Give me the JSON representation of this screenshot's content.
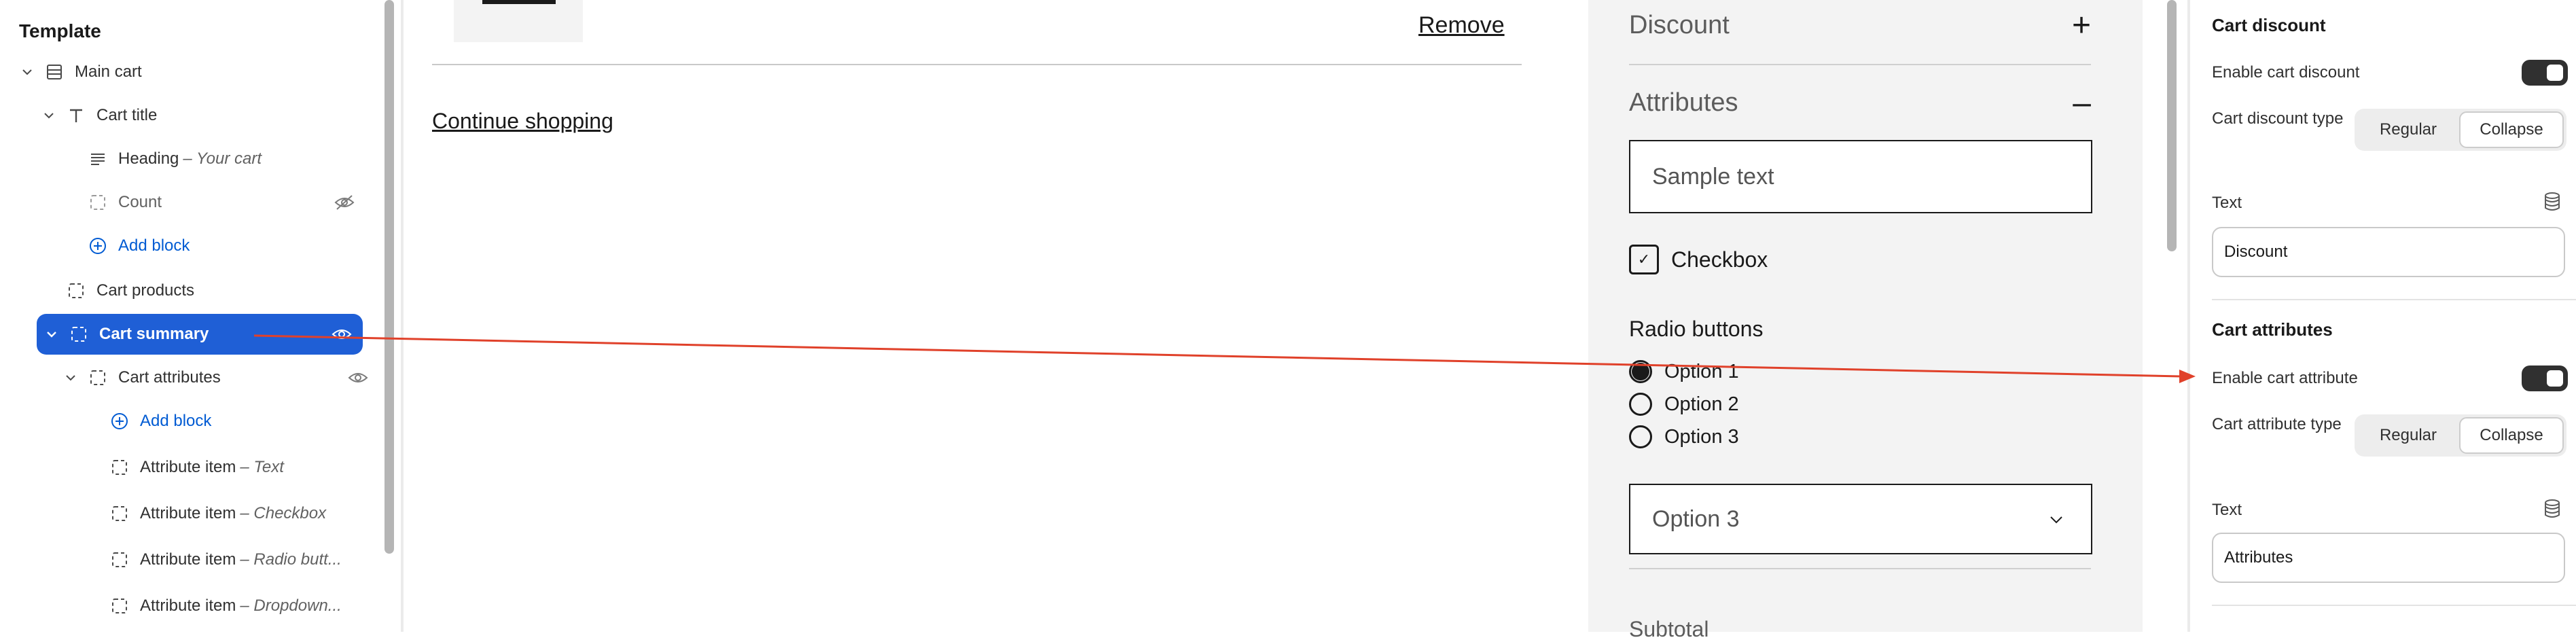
{
  "sidebar": {
    "title": "Template",
    "tree": [
      {
        "label": "Main cart",
        "sub": ""
      },
      {
        "label": "Cart title",
        "sub": ""
      },
      {
        "label": "Heading",
        "sub": "– Your cart"
      },
      {
        "label": "Count",
        "sub": ""
      },
      {
        "label": "Add block",
        "sub": ""
      },
      {
        "label": "Cart products",
        "sub": ""
      },
      {
        "label": "Cart summary",
        "sub": ""
      },
      {
        "label": "Cart attributes",
        "sub": ""
      },
      {
        "label": "Add block",
        "sub": ""
      },
      {
        "label": "Attribute item",
        "sub": "– Text"
      },
      {
        "label": "Attribute item",
        "sub": "– Checkbox"
      },
      {
        "label": "Attribute item",
        "sub": "– Radio butt..."
      },
      {
        "label": "Attribute item",
        "sub": "– Dropdown..."
      }
    ]
  },
  "preview": {
    "remove_label": "Remove",
    "continue_label": "Continue shopping",
    "discount_label": "Discount",
    "attributes_label": "Attributes",
    "sample_text": "Sample text",
    "checkbox_label": "Checkbox",
    "radio_title": "Radio buttons",
    "radio_options": [
      "Option 1",
      "Option 2",
      "Option 3"
    ],
    "radio_selected_index": 0,
    "dropdown_value": "Option 3",
    "subtotal_label": "Subtotal"
  },
  "settings": {
    "discount_heading": "Cart discount",
    "enable_discount_label": "Enable cart discount",
    "discount_type_label": "Cart discount type",
    "segment_regular": "Regular",
    "segment_collapse": "Collapse",
    "text_label": "Text",
    "discount_text_value": "Discount",
    "attributes_heading": "Cart attributes",
    "enable_attribute_label": "Enable cart attribute",
    "attribute_type_label": "Cart attribute type",
    "attribute_text_value": "Attributes",
    "enable_discount_on": true,
    "enable_attribute_on": true,
    "discount_type_selected": "Collapse",
    "attribute_type_selected": "Collapse"
  },
  "colors": {
    "selected_blue": "#1f5fd6",
    "link_blue": "#005bd3",
    "arrow_red": "#e0412a"
  }
}
